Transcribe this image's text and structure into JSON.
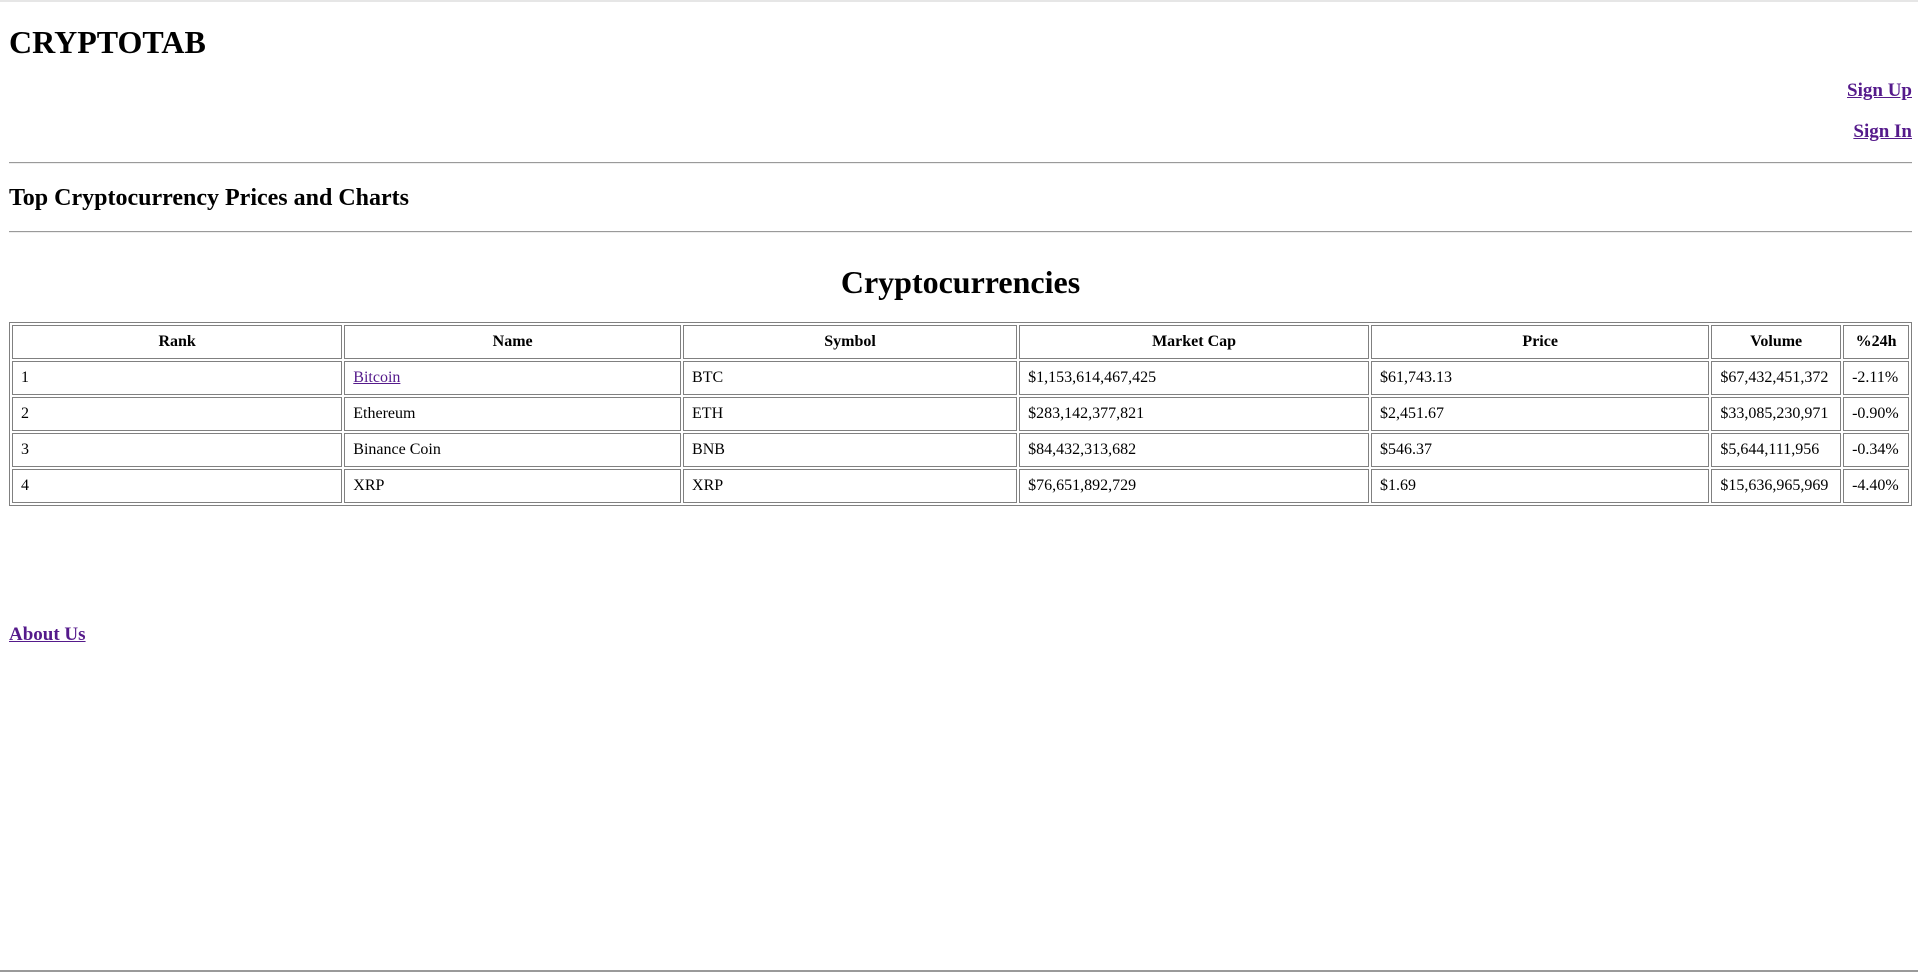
{
  "header": {
    "site_title": "CRYPTOTAB",
    "sign_up": "Sign Up",
    "sign_in": "Sign In"
  },
  "main": {
    "subtitle": "Top Cryptocurrency Prices and Charts",
    "table_title": "Cryptocurrencies",
    "table": {
      "columns": [
        "Rank",
        "Name",
        "Symbol",
        "Market Cap",
        "Price",
        "Volume",
        "%24h"
      ],
      "rows": [
        {
          "rank": "1",
          "name": "Bitcoin",
          "name_is_link": true,
          "symbol": "BTC",
          "market_cap": "$1,153,614,467,425",
          "price": "$61,743.13",
          "volume": "$67,432,451,372",
          "change_24h": "-2.11%"
        },
        {
          "rank": "2",
          "name": "Ethereum",
          "name_is_link": false,
          "symbol": "ETH",
          "market_cap": "$283,142,377,821",
          "price": "$2,451.67",
          "volume": "$33,085,230,971",
          "change_24h": "-0.90%"
        },
        {
          "rank": "3",
          "name": "Binance Coin",
          "name_is_link": false,
          "symbol": "BNB",
          "market_cap": "$84,432,313,682",
          "price": "$546.37",
          "volume": "$5,644,111,956",
          "change_24h": "-0.34%"
        },
        {
          "rank": "4",
          "name": "XRP",
          "name_is_link": false,
          "symbol": "XRP",
          "market_cap": "$76,651,892,729",
          "price": "$1.69",
          "volume": "$15,636,965,969",
          "change_24h": "-4.40%"
        }
      ]
    }
  },
  "footer": {
    "about_us": "About Us"
  },
  "colors": {
    "visited_link": "#551a8b",
    "rule": "#9a9a9a"
  }
}
